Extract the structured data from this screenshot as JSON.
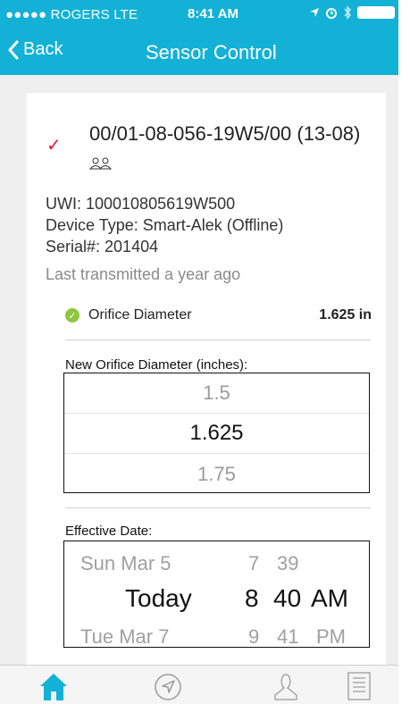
{
  "status_bar": {
    "carrier": "●●●●● ROGERS  LTE",
    "time": "8:41 AM"
  },
  "nav": {
    "back_label": "Back",
    "title": "Sensor Control"
  },
  "well": {
    "name": "00/01-08-056-19W5/00 (13-08)",
    "uwi": "UWI: 100010805619W500",
    "device_type": "Device Type: Smart-Alek (Offline)",
    "serial": "Serial#: 201404",
    "last_transmitted": "Last transmitted a year ago"
  },
  "orifice": {
    "label": "Orifice Diameter",
    "value": "1.625 in"
  },
  "new_orifice": {
    "label": "New Orifice Diameter (inches):",
    "options": [
      "1.5",
      "1.625",
      "1.75"
    ]
  },
  "effective_date": {
    "label": "Effective Date:",
    "rows": [
      {
        "date": "Sun Mar 5",
        "hour": "7",
        "minute": "39",
        "ampm": ""
      },
      {
        "date": "Today",
        "hour": "8",
        "minute": "40",
        "ampm": "AM"
      },
      {
        "date": "Tue Mar 7",
        "hour": "9",
        "minute": "41",
        "ampm": "PM"
      }
    ]
  },
  "colors": {
    "accent": "#13b1d6",
    "check": "#e11b3a",
    "ok": "#8ec63f"
  },
  "tabs": {
    "icons": [
      "home-icon",
      "navigation-icon",
      "user-icon",
      "list-icon"
    ]
  }
}
